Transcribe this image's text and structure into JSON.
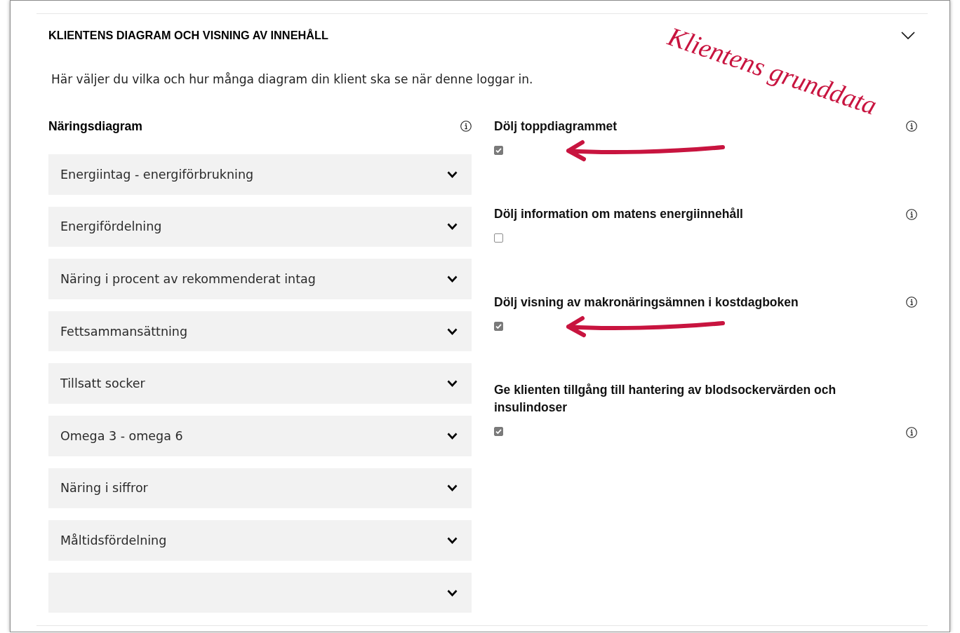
{
  "section": {
    "title": "KLIENTENS DIAGRAM OCH VISNING AV INNEHÅLL",
    "expanded": true,
    "description": "Här väljer du vilka och hur många diagram din klient ska se när denne loggar in."
  },
  "annotation": {
    "text": "Klientens grunddata"
  },
  "nutrition_charts": {
    "heading": "Näringsdiagram",
    "items": [
      {
        "label": "Energiintag - energiförbrukning",
        "expanded": false
      },
      {
        "label": "Energifördelning",
        "expanded": false
      },
      {
        "label": "Näring i procent av rekommenderat intag",
        "expanded": false
      },
      {
        "label": "Fettsammansättning",
        "expanded": false
      },
      {
        "label": "Tillsatt socker",
        "expanded": false
      },
      {
        "label": "Omega 3 - omega 6",
        "expanded": false
      },
      {
        "label": "Näring i siffror",
        "expanded": false
      },
      {
        "label": "Måltidsfördelning",
        "expanded": false
      },
      {
        "expanded": false
      }
    ]
  },
  "settings": [
    {
      "label": "Dölj toppdiagrammet",
      "checked": true,
      "disabled": true,
      "arrow": true
    },
    {
      "label": "Dölj information om matens energiinnehåll",
      "checked": false,
      "disabled": true,
      "arrow": false
    },
    {
      "label": "Dölj visning av makronäringsämnen i kostdagboken",
      "checked": true,
      "disabled": true,
      "arrow": true
    },
    {
      "label": "Ge klienten tillgång till hantering av blodsockervärden och insulindoser",
      "checked": true,
      "disabled": true,
      "arrow": false
    }
  ]
}
